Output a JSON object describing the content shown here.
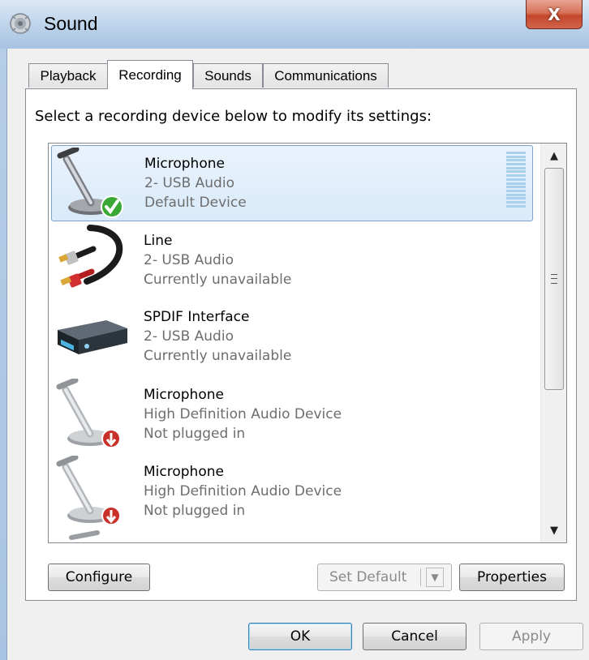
{
  "window": {
    "title": "Sound",
    "close_glyph": "X"
  },
  "tabs": [
    {
      "label": "Playback"
    },
    {
      "label": "Recording"
    },
    {
      "label": "Sounds"
    },
    {
      "label": "Communications"
    }
  ],
  "active_tab": "Recording",
  "instruction": "Select a recording device below to modify its settings:",
  "devices": [
    {
      "name": "Microphone",
      "driver": "2- USB Audio",
      "status": "Default Device",
      "icon": "microphone-default-icon",
      "selected": true
    },
    {
      "name": "Line",
      "driver": "2- USB Audio",
      "status": "Currently unavailable",
      "icon": "line-in-cable-icon"
    },
    {
      "name": "SPDIF Interface",
      "driver": "2- USB Audio",
      "status": "Currently unavailable",
      "icon": "spdif-device-icon"
    },
    {
      "name": "Microphone",
      "driver": "High Definition Audio Device",
      "status": "Not plugged in",
      "icon": "microphone-unplugged-icon"
    },
    {
      "name": "Microphone",
      "driver": "High Definition Audio Device",
      "status": "Not plugged in",
      "icon": "microphone-unplugged-icon"
    }
  ],
  "buttons": {
    "configure": "Configure",
    "set_default": "Set Default",
    "properties": "Properties",
    "ok": "OK",
    "cancel": "Cancel",
    "apply": "Apply"
  },
  "colors": {
    "selection": "#d9eafa",
    "default_check": "#3aa835",
    "unplugged_badge": "#c8302a",
    "close_button": "#c2472b"
  }
}
